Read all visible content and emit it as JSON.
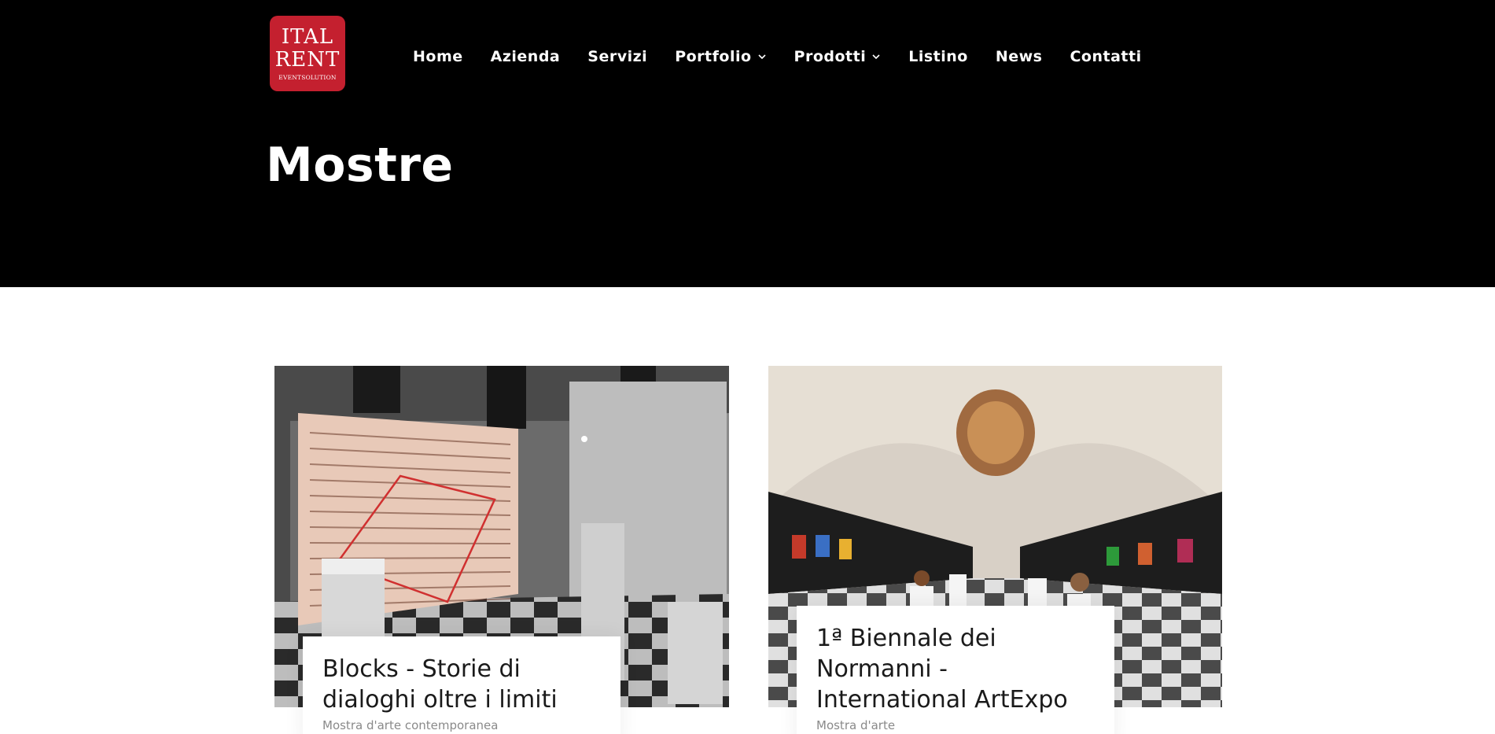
{
  "brand": {
    "logo_line1": "ITAL",
    "logo_line2": "RENT",
    "logo_line3": "EVENTSOLUTION",
    "logo_color": "#c4202f"
  },
  "nav": {
    "items": [
      {
        "label": "Home",
        "has_dropdown": false
      },
      {
        "label": "Azienda",
        "has_dropdown": false
      },
      {
        "label": "Servizi",
        "has_dropdown": false
      },
      {
        "label": "Portfolio",
        "has_dropdown": true,
        "icon": "chevron-down-icon"
      },
      {
        "label": "Prodotti",
        "has_dropdown": true,
        "icon": "chevron-down-icon"
      },
      {
        "label": "Listino",
        "has_dropdown": false
      },
      {
        "label": "News",
        "has_dropdown": false
      },
      {
        "label": "Contatti",
        "has_dropdown": false
      }
    ]
  },
  "page": {
    "title": "Mostre"
  },
  "cards": [
    {
      "title": "Blocks - Storie di dialoghi oltre i limiti",
      "category": "Mostra d'arte contemporanea"
    },
    {
      "title": "1ª Biennale dei Normanni - International ArtExpo",
      "category": "Mostra d'arte"
    }
  ],
  "colors": {
    "header_bg": "#000000",
    "page_bg": "#ffffff",
    "caption_title": "#1a1a1a",
    "caption_sub": "#8a8a8a"
  }
}
